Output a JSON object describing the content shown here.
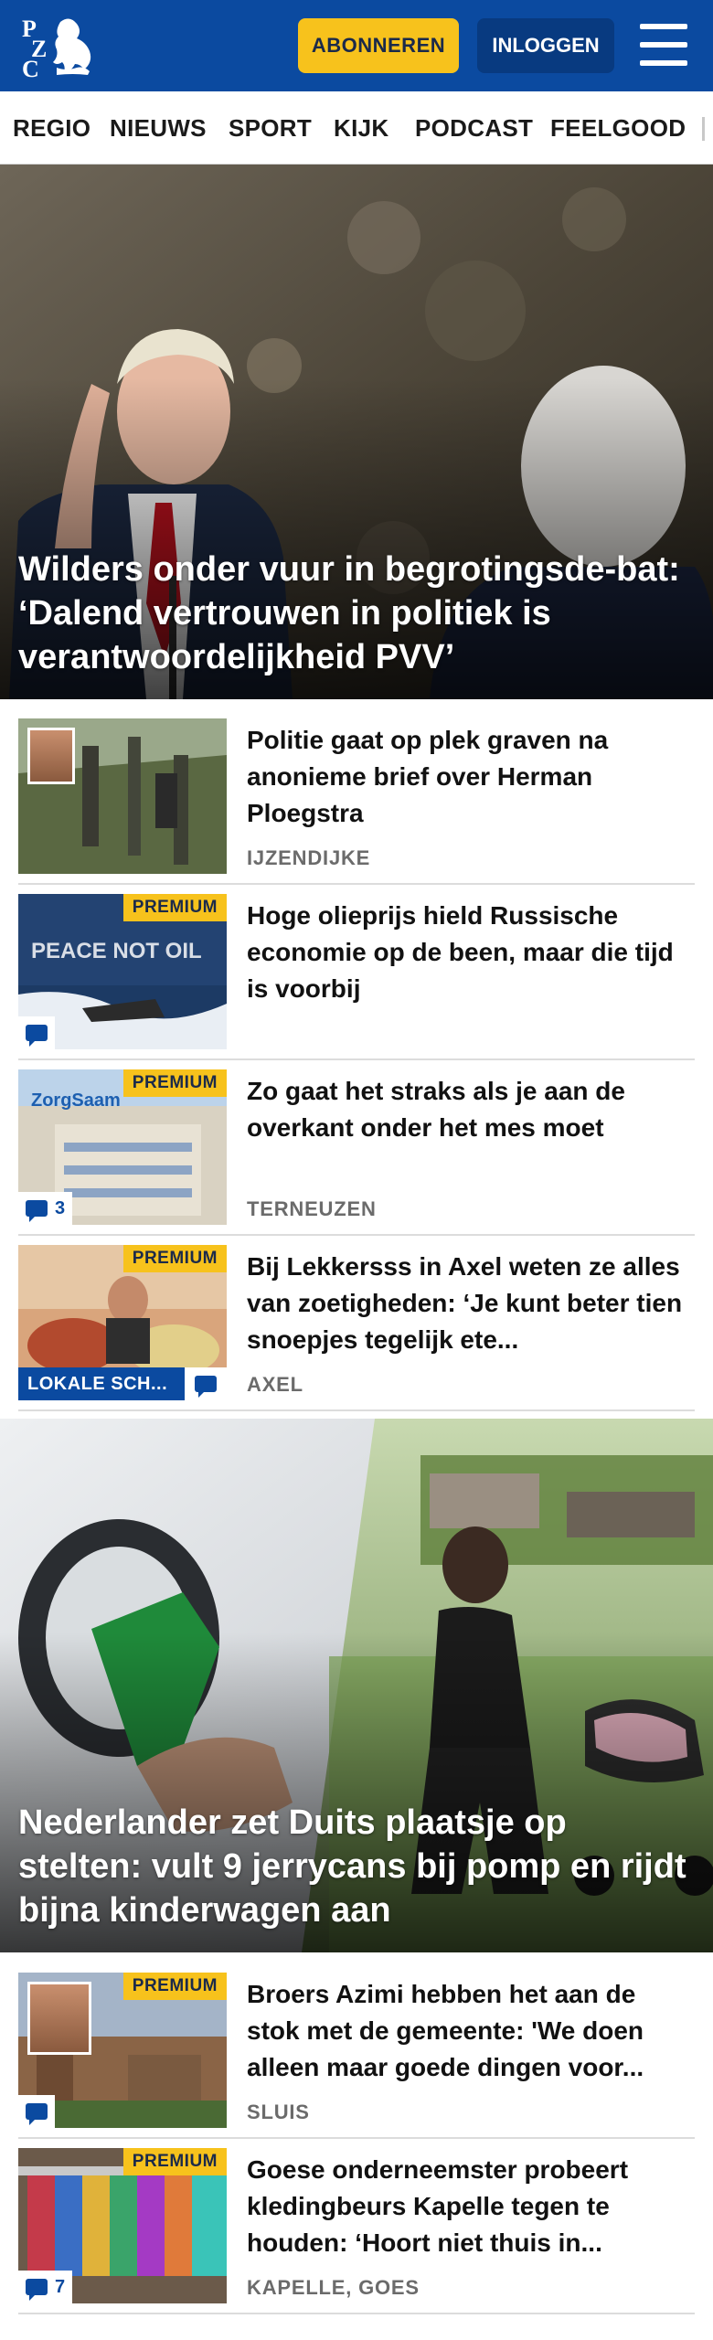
{
  "header": {
    "logo_text": "PZC",
    "subscribe_label": "ABONNEREN",
    "login_label": "INLOGGEN",
    "colors": {
      "brand": "#0b4aa0",
      "accent": "#f7c21c"
    }
  },
  "nav": {
    "items": [
      "REGIO",
      "NIEUWS",
      "SPORT",
      "KIJK",
      "PODCAST",
      "FEELGOOD"
    ]
  },
  "hero1": {
    "title": "Wilders onder vuur in begrotingsde-bat: ‘Dalend vertrouwen in politiek is verantwoordelijkheid PVV’"
  },
  "articles1": [
    {
      "headline": "Politie gaat op plek graven na anonieme brief over Herman Ploegstra",
      "place": "IJZENDIJKE",
      "premium": "",
      "comments": ""
    },
    {
      "headline": "Hoge olieprijs hield Russische economie op de been, maar die tijd is voorbij",
      "place": "",
      "premium": "PREMIUM",
      "comments": ""
    },
    {
      "headline": "Zo gaat het straks als je aan de overkant onder het mes moet",
      "place": "TERNEUZEN",
      "premium": "PREMIUM",
      "comments": "3"
    },
    {
      "headline": "Bij Lekkersss in Axel weten ze alles van zoetigheden: ‘Je kunt beter tien snoepjes tegelijk ete...",
      "place": "AXEL",
      "premium": "PREMIUM",
      "local_tag": "LOKALE SCH..."
    }
  ],
  "hero2": {
    "title": "Nederlander zet Duits plaatsje op stelten: vult 9 jerrycans bij pomp en rijdt bijna kinderwagen aan"
  },
  "articles2": [
    {
      "headline": "Broers Azimi hebben het aan de stok met de gemeente: 'We doen alleen maar goede dingen voor...",
      "place": "SLUIS",
      "premium": "PREMIUM",
      "comments": ""
    },
    {
      "headline": "Goese onderneemster probeert kledingbeurs Kapelle tegen te houden: ‘Hoort niet thuis in...",
      "place": "KAPELLE, GOES",
      "premium": "PREMIUM",
      "comments": "7"
    }
  ]
}
